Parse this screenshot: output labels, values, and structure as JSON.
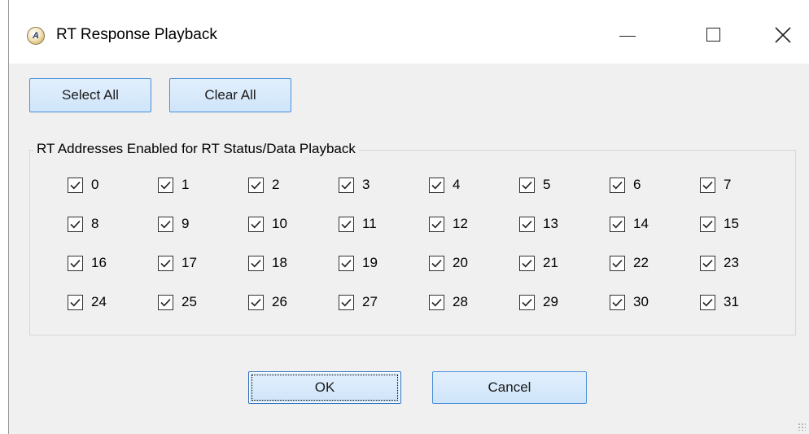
{
  "window": {
    "title": "RT Response Playback",
    "icon": "app-logo-icon",
    "icon_letter": "A⁾"
  },
  "toolbar": {
    "select_all_label": "Select All",
    "clear_all_label": "Clear All"
  },
  "group": {
    "legend": "RT Addresses Enabled for RT Status/Data Playback",
    "checkboxes": [
      {
        "label": "0",
        "checked": true
      },
      {
        "label": "1",
        "checked": true
      },
      {
        "label": "2",
        "checked": true
      },
      {
        "label": "3",
        "checked": true
      },
      {
        "label": "4",
        "checked": true
      },
      {
        "label": "5",
        "checked": true
      },
      {
        "label": "6",
        "checked": true
      },
      {
        "label": "7",
        "checked": true
      },
      {
        "label": "8",
        "checked": true
      },
      {
        "label": "9",
        "checked": true
      },
      {
        "label": "10",
        "checked": true
      },
      {
        "label": "11",
        "checked": true
      },
      {
        "label": "12",
        "checked": true
      },
      {
        "label": "13",
        "checked": true
      },
      {
        "label": "14",
        "checked": true
      },
      {
        "label": "15",
        "checked": true
      },
      {
        "label": "16",
        "checked": true
      },
      {
        "label": "17",
        "checked": true
      },
      {
        "label": "18",
        "checked": true
      },
      {
        "label": "19",
        "checked": true
      },
      {
        "label": "20",
        "checked": true
      },
      {
        "label": "21",
        "checked": true
      },
      {
        "label": "22",
        "checked": true
      },
      {
        "label": "23",
        "checked": true
      },
      {
        "label": "24",
        "checked": true
      },
      {
        "label": "25",
        "checked": true
      },
      {
        "label": "26",
        "checked": true
      },
      {
        "label": "27",
        "checked": true
      },
      {
        "label": "28",
        "checked": true
      },
      {
        "label": "29",
        "checked": true
      },
      {
        "label": "30",
        "checked": true
      },
      {
        "label": "31",
        "checked": true
      }
    ]
  },
  "footer": {
    "ok_label": "OK",
    "cancel_label": "Cancel"
  },
  "colors": {
    "button_border": "#4a8fd8",
    "button_fill": "#d9eafb",
    "dialog_bg": "#f0f0f0"
  }
}
